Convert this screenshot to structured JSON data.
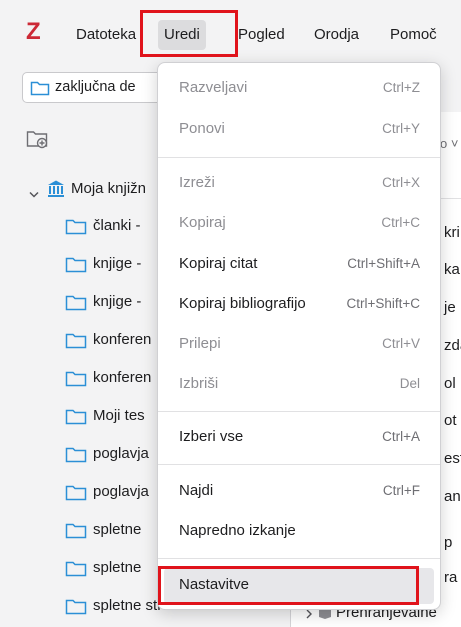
{
  "menubar": {
    "logo": "Z",
    "items": [
      "Datoteka",
      "Uredi",
      "Pogled",
      "Orodja",
      "Pomoč"
    ]
  },
  "collection_tab": {
    "label": "zaključna de"
  },
  "tree": {
    "library": "Moja knjižn",
    "collections": [
      "članki -",
      "knjige -",
      "knjige -",
      "konferen",
      "konferen",
      "Moji tes",
      "poglavja",
      "poglavja",
      "spletne",
      "spletne",
      "spletne strani - ziv..."
    ]
  },
  "items_fragments": {
    "search": "o ˅",
    "rows": [
      "kri",
      "ka",
      "je",
      "zda",
      "ol",
      "ot",
      "est",
      "an",
      "p",
      "ra"
    ],
    "bottom_item": "Prehranjevalne"
  },
  "edit_menu": {
    "items": [
      {
        "label": "Razveljavi",
        "shortcut": "Ctrl+Z",
        "enabled": false
      },
      {
        "label": "Ponovi",
        "shortcut": "Ctrl+Y",
        "enabled": false
      },
      {
        "label": "Izreži",
        "shortcut": "Ctrl+X",
        "enabled": false
      },
      {
        "label": "Kopiraj",
        "shortcut": "Ctrl+C",
        "enabled": false
      },
      {
        "label": "Kopiraj citat",
        "shortcut": "Ctrl+Shift+A",
        "enabled": true
      },
      {
        "label": "Kopiraj bibliografijo",
        "shortcut": "Ctrl+Shift+C",
        "enabled": true
      },
      {
        "label": "Prilepi",
        "shortcut": "Ctrl+V",
        "enabled": false
      },
      {
        "label": "Izbriši",
        "shortcut": "Del",
        "enabled": false
      },
      {
        "label": "Izberi vse",
        "shortcut": "Ctrl+A",
        "enabled": true
      },
      {
        "label": "Najdi",
        "shortcut": "Ctrl+F",
        "enabled": true
      },
      {
        "label": "Napredno izkanje",
        "shortcut": "",
        "enabled": true
      },
      {
        "label": "Nastavitve",
        "shortcut": "",
        "enabled": true
      }
    ]
  },
  "colors": {
    "highlight_box": "#e0131b",
    "folder_icon": "#2b8fd6",
    "logo": "#cc2936"
  }
}
